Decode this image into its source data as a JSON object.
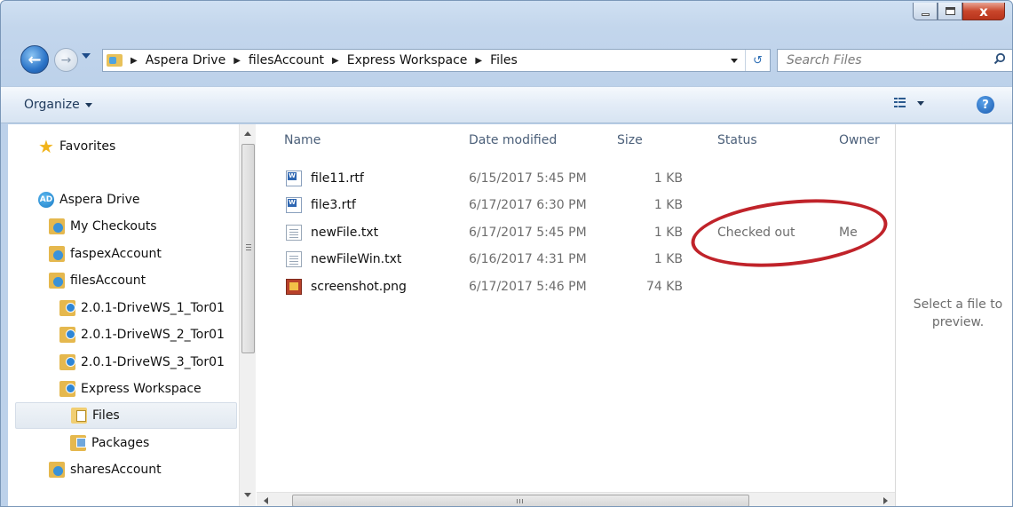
{
  "window": {
    "caption_buttons": {
      "minimize_icon": "minimize-icon",
      "maximize_icon": "maximize-icon",
      "close_glyph": "x"
    }
  },
  "address_bar": {
    "breadcrumbs": [
      "Aspera Drive",
      "filesAccount",
      "Express Workspace",
      "Files"
    ],
    "search_placeholder": "Search Files"
  },
  "toolbar": {
    "organize_label": "Organize",
    "help_glyph": "?"
  },
  "nav_pane": {
    "favorites_label": "Favorites",
    "root_label": "Aspera Drive",
    "root_icon_text": "AD",
    "items": [
      {
        "label": "My Checkouts",
        "icon": "account-icon"
      },
      {
        "label": "faspexAccount",
        "icon": "account-icon"
      },
      {
        "label": "filesAccount",
        "icon": "account-icon"
      },
      {
        "label": "2.0.1-DriveWS_1_Tor01",
        "icon": "workspace-icon"
      },
      {
        "label": "2.0.1-DriveWS_2_Tor01",
        "icon": "workspace-icon"
      },
      {
        "label": "2.0.1-DriveWS_3_Tor01",
        "icon": "workspace-icon"
      },
      {
        "label": "Express Workspace",
        "icon": "workspace-icon"
      },
      {
        "label": "Files",
        "icon": "files-folder-icon",
        "selected": true
      },
      {
        "label": "Packages",
        "icon": "packages-icon"
      },
      {
        "label": "sharesAccount",
        "icon": "account-icon"
      }
    ]
  },
  "file_list": {
    "columns": {
      "name": "Name",
      "date": "Date modified",
      "size": "Size",
      "status": "Status",
      "owner": "Owner"
    },
    "rows": [
      {
        "name": "file11.rtf",
        "date": "6/15/2017 5:45 PM",
        "size": "1 KB",
        "status": "",
        "owner": "",
        "icon": "rtf-icon"
      },
      {
        "name": "file3.rtf",
        "date": "6/17/2017 6:30 PM",
        "size": "1 KB",
        "status": "",
        "owner": "",
        "icon": "rtf-icon"
      },
      {
        "name": "newFile.txt",
        "date": "6/17/2017 5:45 PM",
        "size": "1 KB",
        "status": "Checked out",
        "owner": "Me",
        "icon": "txt-icon"
      },
      {
        "name": "newFileWin.txt",
        "date": "6/16/2017 4:31 PM",
        "size": "1 KB",
        "status": "",
        "owner": "",
        "icon": "txt-icon"
      },
      {
        "name": "screenshot.png",
        "date": "6/17/2017 5:46 PM",
        "size": "74 KB",
        "status": "",
        "owner": "",
        "icon": "png-icon"
      }
    ],
    "highlight_color": "#c0232a"
  },
  "preview_pane": {
    "message": "Select a file to preview."
  }
}
